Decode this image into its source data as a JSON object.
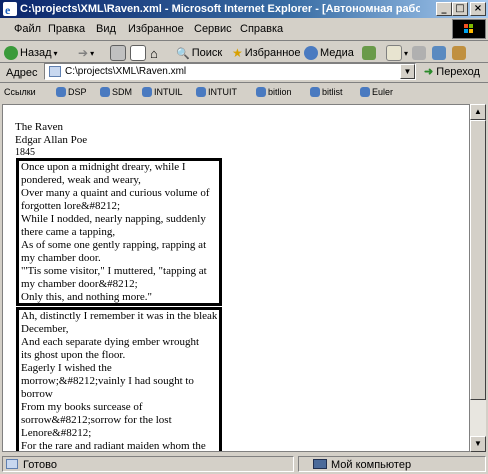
{
  "window": {
    "title": "C:\\projects\\XML\\Raven.xml - Microsoft Internet Explorer - [Автономная рабо",
    "minimize": "_",
    "maximize": "□",
    "close": "×"
  },
  "menu": [
    "Файл",
    "Правка",
    "Вид",
    "Избранное",
    "Сервис",
    "Справка"
  ],
  "toolbar": {
    "back": "Назад",
    "search": "Поиск",
    "favorites": "Избранное",
    "media": "Медиа"
  },
  "address": {
    "label": "Адрес",
    "value": "C:\\projects\\XML\\Raven.xml",
    "go": "Переход"
  },
  "links": {
    "label": "Ссылки",
    "items": [
      "DSP",
      "SDM",
      "INTUIL",
      "INTUIT",
      "bitlion",
      "bitlist",
      "Euler"
    ]
  },
  "document": {
    "title": "The Raven",
    "author": "Edgar Allan Poe",
    "year": "1845",
    "stanza1": [
      "Once upon a midnight dreary, while I",
      "pondered, weak and weary,",
      "Over many a quaint and curious volume of",
      "forgotten lore&#8212;",
      "While I nodded, nearly napping, suddenly",
      "there came a tapping,",
      "As of some one gently rapping, rapping at",
      "my chamber door.",
      "\"'Tis some visitor,\" I muttered, \"tapping at",
      "my chamber door&#8212;",
      "Only this, and nothing more.\""
    ],
    "stanza2": [
      "Ah, distinctly I remember it was in the bleak",
      "December,",
      "And each separate dying ember wrought",
      "its ghost upon the floor.",
      "Eagerly I wished the",
      "morrow;&#8212;vainly I had sought to",
      "borrow",
      "From my books surcease of",
      "sorrow&#8212;sorrow for the lost",
      "Lenore&#8212;",
      "For the rare and radiant maiden whom the"
    ]
  },
  "status": {
    "left": "Готово",
    "right": "Мой компьютер"
  }
}
